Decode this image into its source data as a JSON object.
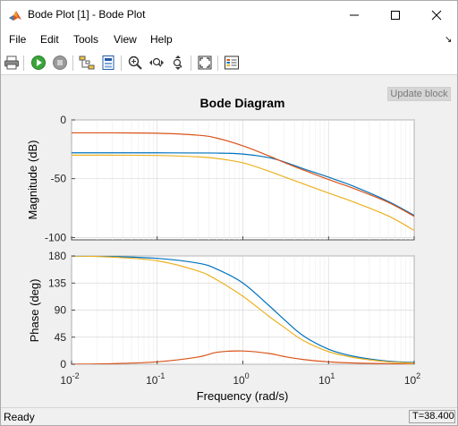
{
  "window": {
    "title": "Bode Plot [1] - Bode Plot",
    "icon": "matlab-logo-icon"
  },
  "menu": {
    "items": [
      "File",
      "Edit",
      "Tools",
      "View",
      "Help"
    ]
  },
  "toolbar": {
    "buttons": [
      "print-icon",
      "run-icon",
      "stop-icon",
      "signal-selector-icon",
      "config-icon",
      "zoom-in-icon",
      "zoom-x-icon",
      "zoom-y-icon",
      "fit-to-view-icon",
      "legend-icon"
    ]
  },
  "update_button": {
    "label": "Update block"
  },
  "status": {
    "text": "Ready",
    "time": "T=38.400"
  },
  "colors": {
    "blue": "#0072BD",
    "red": "#D95319",
    "yellow": "#EDB120"
  },
  "chart_data": {
    "type": "line",
    "title": "Bode Diagram",
    "xlabel": "Frequency  (rad/s)",
    "x_scale": "log",
    "xlim": [
      0.01,
      100
    ],
    "x_ticks": [
      0.01,
      0.1,
      1,
      10,
      100
    ],
    "x_tick_labels": [
      {
        "base": "10",
        "exp": "-2"
      },
      {
        "base": "10",
        "exp": "-1"
      },
      {
        "base": "10",
        "exp": "0"
      },
      {
        "base": "10",
        "exp": "1"
      },
      {
        "base": "10",
        "exp": "2"
      }
    ],
    "grid": true,
    "x": [
      0.01,
      0.03,
      0.1,
      0.3,
      0.5,
      1,
      2,
      3,
      5,
      10,
      20,
      50,
      100
    ],
    "magnitude": {
      "ylabel": "Magnitude (dB)",
      "ylim": [
        -102,
        0
      ],
      "y_ticks": [
        0,
        -50,
        -100
      ],
      "y_tick_labels": [
        "0",
        "-50",
        "-100"
      ],
      "series": [
        {
          "color": "#0072BD",
          "values": [
            -28,
            -28,
            -28,
            -28.1,
            -28.2,
            -29,
            -32,
            -35.6,
            -41.3,
            -48.7,
            -56.7,
            -69.4,
            -81.2
          ]
        },
        {
          "color": "#D95319",
          "values": [
            -11,
            -11,
            -11.3,
            -13,
            -15.5,
            -22,
            -30.5,
            -36,
            -42.4,
            -50.7,
            -58.5,
            -70.2,
            -82
          ]
        },
        {
          "color": "#EDB120",
          "values": [
            -30,
            -30,
            -30.2,
            -31.4,
            -32.8,
            -36.5,
            -43.5,
            -48.3,
            -54.2,
            -62.2,
            -70,
            -81.7,
            -94
          ]
        }
      ]
    },
    "phase": {
      "ylabel": "Phase (deg)",
      "ylim": [
        0,
        180
      ],
      "y_ticks": [
        0,
        45,
        90,
        135,
        180
      ],
      "y_tick_labels": [
        "0",
        "45",
        "90",
        "135",
        "180"
      ],
      "series": [
        {
          "color": "#0072BD",
          "values": [
            180,
            179,
            176,
            168,
            158,
            135,
            98,
            75,
            48,
            25,
            13,
            5,
            3
          ]
        },
        {
          "color": "#D95319",
          "values": [
            0,
            1,
            4,
            12,
            20,
            22,
            18,
            13,
            8,
            4,
            2,
            1,
            0
          ]
        },
        {
          "color": "#EDB120",
          "values": [
            180,
            178,
            172,
            155,
            140,
            113,
            80,
            62,
            40,
            21,
            11,
            4,
            2
          ]
        }
      ]
    }
  }
}
